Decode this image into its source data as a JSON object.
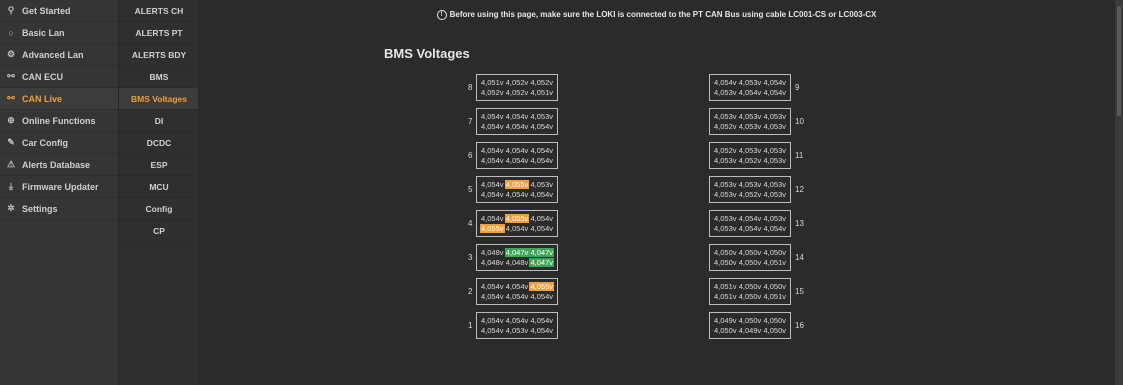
{
  "sidebar": {
    "items": [
      {
        "label": "Get Started",
        "icon": "pin-icon",
        "glyph": "⚲"
      },
      {
        "label": "Basic Lan",
        "icon": "circle-icon",
        "glyph": "○"
      },
      {
        "label": "Advanced Lan",
        "icon": "gear-icon",
        "glyph": "⚙"
      },
      {
        "label": "CAN ECU",
        "icon": "network-icon",
        "glyph": "⚯"
      },
      {
        "label": "CAN Live",
        "icon": "network-icon",
        "glyph": "⚯",
        "active": true
      },
      {
        "label": "Online Functions",
        "icon": "globe-icon",
        "glyph": "⊕"
      },
      {
        "label": "Car Config",
        "icon": "edit-icon",
        "glyph": "✎"
      },
      {
        "label": "Alerts Database",
        "icon": "warning-icon",
        "glyph": "⚠"
      },
      {
        "label": "Firmware Updater",
        "icon": "download-icon",
        "glyph": "⤓"
      },
      {
        "label": "Settings",
        "icon": "settings-icon",
        "glyph": "✲"
      }
    ]
  },
  "subnav": {
    "items": [
      {
        "label": "ALERTS CH"
      },
      {
        "label": "ALERTS PT"
      },
      {
        "label": "ALERTS BDY"
      },
      {
        "label": "BMS"
      },
      {
        "label": "BMS Voltages",
        "active": true
      },
      {
        "label": "DI"
      },
      {
        "label": "DCDC"
      },
      {
        "label": "ESP"
      },
      {
        "label": "MCU"
      },
      {
        "label": "Config"
      },
      {
        "label": "CP"
      }
    ]
  },
  "main": {
    "notice": "Before using this page, make sure the LOKI is connected to the PT CAN Bus using cable LC001-CS or LC003-CX",
    "notice_icon": "info-icon",
    "title": "BMS Voltages"
  },
  "colors": {
    "high": "#f0a03a",
    "low": "#3da657",
    "accent": "#f0a03a"
  },
  "modules": {
    "left": [
      {
        "num": "8",
        "rows": [
          [
            {
              "v": "4,051v"
            },
            {
              "v": "4,052v"
            },
            {
              "v": "4,052v"
            }
          ],
          [
            {
              "v": "4,052v"
            },
            {
              "v": "4,052v"
            },
            {
              "v": "4,051v"
            }
          ]
        ]
      },
      {
        "num": "7",
        "rows": [
          [
            {
              "v": "4,054v"
            },
            {
              "v": "4,054v"
            },
            {
              "v": "4,053v"
            }
          ],
          [
            {
              "v": "4,054v"
            },
            {
              "v": "4,054v"
            },
            {
              "v": "4,054v"
            }
          ]
        ]
      },
      {
        "num": "6",
        "rows": [
          [
            {
              "v": "4,054v"
            },
            {
              "v": "4,054v"
            },
            {
              "v": "4,054v"
            }
          ],
          [
            {
              "v": "4,054v"
            },
            {
              "v": "4,054v"
            },
            {
              "v": "4,054v"
            }
          ]
        ]
      },
      {
        "num": "5",
        "rows": [
          [
            {
              "v": "4,054v"
            },
            {
              "v": "4,055v",
              "s": "high"
            },
            {
              "v": "4,053v"
            }
          ],
          [
            {
              "v": "4,054v"
            },
            {
              "v": "4,054v"
            },
            {
              "v": "4,054v"
            }
          ]
        ]
      },
      {
        "num": "4",
        "rows": [
          [
            {
              "v": "4,054v"
            },
            {
              "v": "4,055v",
              "s": "high"
            },
            {
              "v": "4,054v"
            }
          ],
          [
            {
              "v": "4,055v",
              "s": "high"
            },
            {
              "v": "4,054v"
            },
            {
              "v": "4,054v"
            }
          ]
        ]
      },
      {
        "num": "3",
        "rows": [
          [
            {
              "v": "4,048v"
            },
            {
              "v": "4,047v",
              "s": "low"
            },
            {
              "v": "4,047v",
              "s": "low"
            }
          ],
          [
            {
              "v": "4,048v"
            },
            {
              "v": "4,048v"
            },
            {
              "v": "4,047v",
              "s": "low"
            }
          ]
        ]
      },
      {
        "num": "2",
        "rows": [
          [
            {
              "v": "4,054v"
            },
            {
              "v": "4,054v"
            },
            {
              "v": "4,055v",
              "s": "high"
            }
          ],
          [
            {
              "v": "4,054v"
            },
            {
              "v": "4,054v"
            },
            {
              "v": "4,054v"
            }
          ]
        ]
      },
      {
        "num": "1",
        "rows": [
          [
            {
              "v": "4,054v"
            },
            {
              "v": "4,054v"
            },
            {
              "v": "4,054v"
            }
          ],
          [
            {
              "v": "4,054v"
            },
            {
              "v": "4,053v"
            },
            {
              "v": "4,054v"
            }
          ]
        ]
      }
    ],
    "right": [
      {
        "num": "9",
        "rows": [
          [
            {
              "v": "4,054v"
            },
            {
              "v": "4,053v"
            },
            {
              "v": "4,054v"
            }
          ],
          [
            {
              "v": "4,053v"
            },
            {
              "v": "4,054v"
            },
            {
              "v": "4,054v"
            }
          ]
        ]
      },
      {
        "num": "10",
        "rows": [
          [
            {
              "v": "4,053v"
            },
            {
              "v": "4,053v"
            },
            {
              "v": "4,053v"
            }
          ],
          [
            {
              "v": "4,052v"
            },
            {
              "v": "4,053v"
            },
            {
              "v": "4,053v"
            }
          ]
        ]
      },
      {
        "num": "11",
        "rows": [
          [
            {
              "v": "4,052v"
            },
            {
              "v": "4,053v"
            },
            {
              "v": "4,053v"
            }
          ],
          [
            {
              "v": "4,053v"
            },
            {
              "v": "4,052v"
            },
            {
              "v": "4,053v"
            }
          ]
        ]
      },
      {
        "num": "12",
        "rows": [
          [
            {
              "v": "4,053v"
            },
            {
              "v": "4,053v"
            },
            {
              "v": "4,053v"
            }
          ],
          [
            {
              "v": "4,053v"
            },
            {
              "v": "4,052v"
            },
            {
              "v": "4,053v"
            }
          ]
        ]
      },
      {
        "num": "13",
        "rows": [
          [
            {
              "v": "4,053v"
            },
            {
              "v": "4,054v"
            },
            {
              "v": "4,053v"
            }
          ],
          [
            {
              "v": "4,053v"
            },
            {
              "v": "4,054v"
            },
            {
              "v": "4,054v"
            }
          ]
        ]
      },
      {
        "num": "14",
        "rows": [
          [
            {
              "v": "4,050v"
            },
            {
              "v": "4,050v"
            },
            {
              "v": "4,050v"
            }
          ],
          [
            {
              "v": "4,050v"
            },
            {
              "v": "4,050v"
            },
            {
              "v": "4,051v"
            }
          ]
        ]
      },
      {
        "num": "15",
        "rows": [
          [
            {
              "v": "4,051v"
            },
            {
              "v": "4,050v"
            },
            {
              "v": "4,050v"
            }
          ],
          [
            {
              "v": "4,051v"
            },
            {
              "v": "4,050v"
            },
            {
              "v": "4,051v"
            }
          ]
        ]
      },
      {
        "num": "16",
        "rows": [
          [
            {
              "v": "4,049v"
            },
            {
              "v": "4,050v"
            },
            {
              "v": "4,050v"
            }
          ],
          [
            {
              "v": "4,050v"
            },
            {
              "v": "4,049v"
            },
            {
              "v": "4,050v"
            }
          ]
        ]
      }
    ]
  }
}
